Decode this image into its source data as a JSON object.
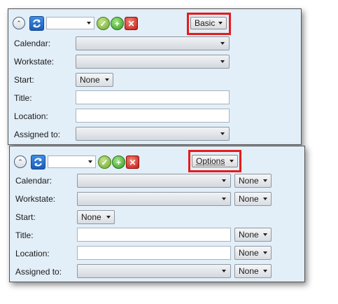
{
  "panel_basic": {
    "mode_label": "Basic",
    "fields": {
      "calendar_label": "Calendar:",
      "workstate_label": "Workstate:",
      "start_label": "Start:",
      "start_value": "None",
      "title_label": "Title:",
      "location_label": "Location:",
      "assigned_label": "Assigned to:"
    }
  },
  "panel_options": {
    "mode_label": "Options",
    "fields": {
      "calendar_label": "Calendar:",
      "calendar_option": "None",
      "workstate_label": "Workstate:",
      "workstate_option": "None",
      "start_label": "Start:",
      "start_value": "None",
      "title_label": "Title:",
      "title_option": "None",
      "location_label": "Location:",
      "location_option": "None",
      "assigned_label": "Assigned to:",
      "assigned_option": "None"
    }
  },
  "colors": {
    "panel_bg": "#e2eef8",
    "highlight": "#e41c1c"
  },
  "icons": [
    "collapse-icon",
    "refresh-icon",
    "check-icon",
    "add-icon",
    "delete-icon",
    "chevron-down-icon"
  ]
}
